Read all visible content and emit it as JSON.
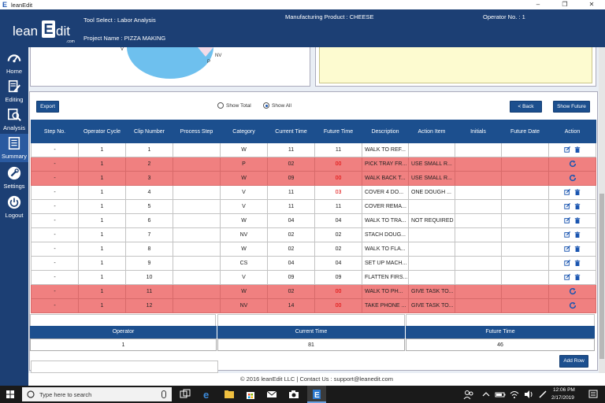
{
  "window": {
    "app_title": "leanEdit"
  },
  "header": {
    "logo": {
      "lean": "lean",
      "e": "E",
      "dit": "dit",
      "dotcom": ".com"
    },
    "tool_select": "Tool Select : Labor Analysis",
    "project_name": "Project Name : PIZZA MAKING",
    "product": "Manufacturing Product : CHEESE",
    "operator": "Operator No. : 1"
  },
  "sidebar": {
    "items": [
      {
        "label": "Home",
        "icon": "speedometer-icon"
      },
      {
        "label": "Editing",
        "icon": "edit-doc-icon"
      },
      {
        "label": "Analysis",
        "icon": "analysis-icon"
      },
      {
        "label": "Summary",
        "icon": "summary-icon"
      },
      {
        "label": "Settings",
        "icon": "wrench-icon"
      },
      {
        "label": "Logout",
        "icon": "power-icon"
      }
    ]
  },
  "chart_partial": {
    "labels": [
      "V",
      "NV",
      "P"
    ]
  },
  "toolbar": {
    "export": "Export",
    "show_total": "Show Total",
    "show_all": "Show All",
    "selected": "show_all",
    "back": "< Back",
    "show_future": "Show Future"
  },
  "table": {
    "columns": [
      "Step No.",
      "Operator Cycle",
      "Clip Number",
      "Process Step",
      "Category",
      "Current Time",
      "Future Time",
      "Description",
      "Action Item",
      "Initials",
      "Future Date",
      "Action"
    ],
    "rows": [
      {
        "step": "-",
        "cycle": "1",
        "clip": "1",
        "process": "",
        "category": "W",
        "current": "11",
        "future": "11",
        "future_red": false,
        "desc": "WALK TO REF...",
        "action_item": "",
        "initials": "",
        "future_date": "",
        "highlight": false,
        "action": "edit-delete"
      },
      {
        "step": "-",
        "cycle": "1",
        "clip": "2",
        "process": "",
        "category": "P",
        "current": "02",
        "future": "00",
        "future_red": true,
        "desc": "PICK TRAY FR...",
        "action_item": "USE SMALL R...",
        "initials": "",
        "future_date": "",
        "highlight": true,
        "action": "refresh"
      },
      {
        "step": "-",
        "cycle": "1",
        "clip": "3",
        "process": "",
        "category": "W",
        "current": "09",
        "future": "00",
        "future_red": true,
        "desc": "WALK BACK T...",
        "action_item": "USE SMALL R...",
        "initials": "",
        "future_date": "",
        "highlight": true,
        "action": "refresh"
      },
      {
        "step": "-",
        "cycle": "1",
        "clip": "4",
        "process": "",
        "category": "V",
        "current": "11",
        "future": "03",
        "future_red": true,
        "desc": "COVER 4 DO...",
        "action_item": "ONE DOUGH ...",
        "initials": "",
        "future_date": "",
        "highlight": false,
        "action": "edit-delete"
      },
      {
        "step": "-",
        "cycle": "1",
        "clip": "5",
        "process": "",
        "category": "V",
        "current": "11",
        "future": "11",
        "future_red": false,
        "desc": "COVER REMA...",
        "action_item": "",
        "initials": "",
        "future_date": "",
        "highlight": false,
        "action": "edit-delete"
      },
      {
        "step": "-",
        "cycle": "1",
        "clip": "6",
        "process": "",
        "category": "W",
        "current": "04",
        "future": "04",
        "future_red": false,
        "desc": "WALK TO TRA...",
        "action_item": "NOT REQUIRED",
        "initials": "",
        "future_date": "",
        "highlight": false,
        "action": "edit-delete"
      },
      {
        "step": "-",
        "cycle": "1",
        "clip": "7",
        "process": "",
        "category": "NV",
        "current": "02",
        "future": "02",
        "future_red": false,
        "desc": "STACH DOUG...",
        "action_item": "",
        "initials": "",
        "future_date": "",
        "highlight": false,
        "action": "edit-delete"
      },
      {
        "step": "-",
        "cycle": "1",
        "clip": "8",
        "process": "",
        "category": "W",
        "current": "02",
        "future": "02",
        "future_red": false,
        "desc": "WALK TO FLA...",
        "action_item": "",
        "initials": "",
        "future_date": "",
        "highlight": false,
        "action": "edit-delete"
      },
      {
        "step": "-",
        "cycle": "1",
        "clip": "9",
        "process": "",
        "category": "CS",
        "current": "04",
        "future": "04",
        "future_red": false,
        "desc": "SET UP MACH...",
        "action_item": "",
        "initials": "",
        "future_date": "",
        "highlight": false,
        "action": "edit-delete"
      },
      {
        "step": "-",
        "cycle": "1",
        "clip": "10",
        "process": "",
        "category": "V",
        "current": "09",
        "future": "09",
        "future_red": false,
        "desc": "FLATTEN FIRS...",
        "action_item": "",
        "initials": "",
        "future_date": "",
        "highlight": false,
        "action": "edit-delete"
      },
      {
        "step": "-",
        "cycle": "1",
        "clip": "11",
        "process": "",
        "category": "W",
        "current": "02",
        "future": "00",
        "future_red": true,
        "desc": "WALK TO PH...",
        "action_item": "GIVE TASK TO...",
        "initials": "",
        "future_date": "",
        "highlight": true,
        "action": "refresh"
      },
      {
        "step": "-",
        "cycle": "1",
        "clip": "12",
        "process": "",
        "category": "NV",
        "current": "14",
        "future": "00",
        "future_red": true,
        "desc": "TAKE PHONE ...",
        "action_item": "GIVE TASK TO...",
        "initials": "",
        "future_date": "",
        "highlight": true,
        "action": "refresh"
      }
    ]
  },
  "summary": {
    "headers": {
      "operator": "Operator",
      "current": "Current Time",
      "future": "Future Time"
    },
    "values": {
      "operator": "1",
      "current": "81",
      "future": "46"
    }
  },
  "add_row": "Add Row",
  "footer": "© 2016 leanEdit LLC | Contact Us : support@leanedit.com",
  "taskbar": {
    "search_placeholder": "Type here to search",
    "time": "12:06 PM",
    "date": "2/17/2019"
  },
  "colors": {
    "header": "#1c3f74",
    "table_header": "#1c4f8e",
    "highlight_row": "#f08080",
    "future_red": "#e00000",
    "action_icon": "#1a55b0"
  }
}
